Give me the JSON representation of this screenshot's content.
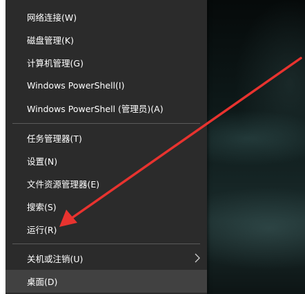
{
  "menu": {
    "items": [
      {
        "label": "网络连接(W)"
      },
      {
        "label": "磁盘管理(K)"
      },
      {
        "label": "计算机管理(G)"
      },
      {
        "label": "Windows PowerShell(I)"
      },
      {
        "label": "Windows PowerShell (管理员)(A)"
      },
      {
        "label": "任务管理器(T)"
      },
      {
        "label": "设置(N)"
      },
      {
        "label": "文件资源管理器(E)"
      },
      {
        "label": "搜索(S)"
      },
      {
        "label": "运行(R)"
      },
      {
        "label": "关机或注销(U)"
      },
      {
        "label": "桌面(D)"
      }
    ]
  },
  "colors": {
    "menu_bg": "#2b2b2b",
    "highlight_bg": "#414141",
    "separator": "#5a5a5a",
    "annotation_arrow": "#e8332f"
  },
  "icons": {
    "submenu": "chevron-right-icon"
  }
}
